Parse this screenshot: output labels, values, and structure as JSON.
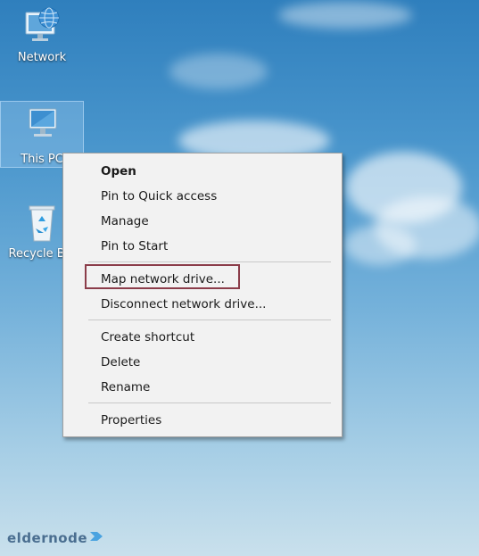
{
  "desktop": {
    "icons": [
      {
        "label": "Network",
        "icon": "network-globe-icon"
      },
      {
        "label": "This PC",
        "icon": "computer-monitor-icon"
      },
      {
        "label": "Recycle Bin",
        "icon": "recycle-bin-icon"
      }
    ]
  },
  "context_menu": {
    "items": [
      {
        "label": "Open",
        "bold": true
      },
      {
        "label": "Pin to Quick access"
      },
      {
        "label": "Manage"
      },
      {
        "label": "Pin to Start"
      },
      {
        "label": "Map network drive...",
        "highlighted": true
      },
      {
        "label": "Disconnect network drive..."
      },
      {
        "label": "Create shortcut"
      },
      {
        "label": "Delete"
      },
      {
        "label": "Rename"
      },
      {
        "label": "Properties"
      }
    ],
    "highlight_color": "#8b3d4a"
  },
  "watermark": {
    "text": "eldernode",
    "icon": "arrow-right-icon",
    "color": "#4a6e90"
  }
}
